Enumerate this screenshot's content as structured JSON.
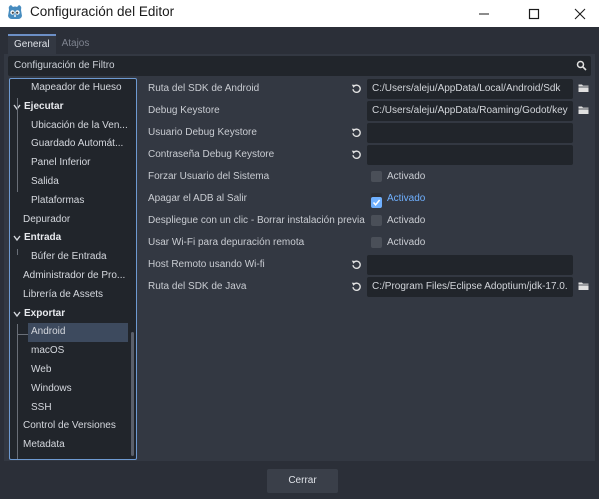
{
  "window": {
    "title": "Configuración del Editor",
    "logo_icon": "godot-logo-icon",
    "logo_color": "#478cbf"
  },
  "tabs": [
    {
      "label": "General",
      "active": true
    },
    {
      "label": "Atajos",
      "active": false
    }
  ],
  "filter": {
    "label": "Configuración de Filtro",
    "icon": "search-icon"
  },
  "tree": {
    "items": [
      {
        "label": "Mapeador de Hueso",
        "level": 1
      },
      {
        "label": "Ejecutar",
        "level": 0,
        "section": true,
        "expanded": true
      },
      {
        "label": "Ubicación de la Ven...",
        "level": 1
      },
      {
        "label": "Guardado Automát...",
        "level": 1
      },
      {
        "label": "Panel Inferior",
        "level": 1
      },
      {
        "label": "Salida",
        "level": 1
      },
      {
        "label": "Plataformas",
        "level": 1
      },
      {
        "label": "Depurador",
        "level": 0
      },
      {
        "label": "Entrada",
        "level": 0,
        "section": true,
        "expanded": true
      },
      {
        "label": "Búfer de Entrada",
        "level": 1
      },
      {
        "label": "Administrador de Pro...",
        "level": 0
      },
      {
        "label": "Librería de Assets",
        "level": 0
      },
      {
        "label": "Exportar",
        "level": 0,
        "section": true,
        "expanded": true
      },
      {
        "label": "Android",
        "level": 1,
        "selected": true
      },
      {
        "label": "macOS",
        "level": 1
      },
      {
        "label": "Web",
        "level": 1
      },
      {
        "label": "Windows",
        "level": 1
      },
      {
        "label": "SSH",
        "level": 1
      },
      {
        "label": "Control de Versiones",
        "level": 0
      },
      {
        "label": "Metadata",
        "level": 0
      }
    ]
  },
  "settings": [
    {
      "label": "Ruta del SDK de Android",
      "type": "path",
      "value": "C:/Users/aleju/AppData/Local/Android/Sdk",
      "revert": true,
      "folder": true
    },
    {
      "label": "Debug Keystore",
      "type": "path",
      "value": "C:/Users/aleju/AppData/Roaming/Godot/key",
      "revert": false,
      "folder": true
    },
    {
      "label": "Usuario Debug Keystore",
      "type": "text",
      "value": "",
      "revert": true,
      "folder": false
    },
    {
      "label": "Contraseña Debug Keystore",
      "type": "text",
      "value": "",
      "revert": true,
      "folder": false
    },
    {
      "label": "Forzar Usuario del Sistema",
      "type": "check",
      "checked": false,
      "check_label": "Activado"
    },
    {
      "label": "Apagar el ADB al Salir",
      "type": "check",
      "checked": true,
      "check_label": "Activado"
    },
    {
      "label": "Despliegue con un clic - Borrar instalación previa",
      "type": "check",
      "checked": false,
      "check_label": "Activado"
    },
    {
      "label": "Usar Wi-Fi para depuración remota",
      "type": "check",
      "checked": false,
      "check_label": "Activado"
    },
    {
      "label": "Host Remoto usando Wi-fi",
      "type": "text",
      "value": "",
      "revert": true,
      "folder": false
    },
    {
      "label": "Ruta del SDK de Java",
      "type": "path",
      "value": "C:/Program Files/Eclipse Adoptium/jdk-17.0.",
      "revert": true,
      "folder": true
    }
  ],
  "footer": {
    "close_label": "Cerrar"
  },
  "colors": {
    "accent": "#6e9ad1",
    "check_on": "#6fb0ff",
    "panel": "#333842",
    "field": "#21252b"
  }
}
